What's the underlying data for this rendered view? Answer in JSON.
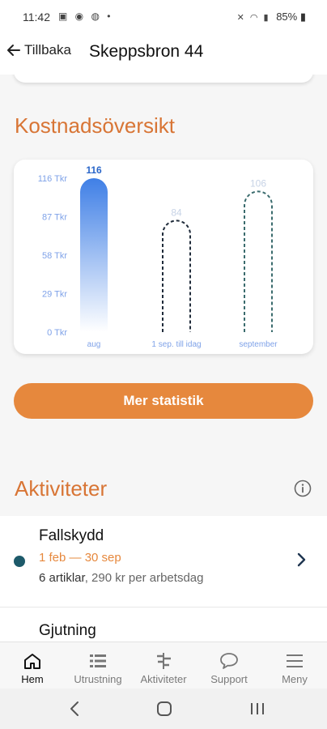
{
  "status_bar": {
    "time": "11:42",
    "battery": "85%"
  },
  "header": {
    "back_label": "Tillbaka",
    "title": "Skeppsbron 44"
  },
  "cost": {
    "section_title": "Kostnadsöversikt",
    "more_button": "Mer statistik",
    "chart_data": {
      "type": "bar",
      "categories": [
        "aug",
        "1 sep. till idag",
        "september"
      ],
      "series": [
        {
          "values": [
            116,
            84,
            106
          ]
        }
      ],
      "value_labels": [
        "116",
        "84",
        "106"
      ],
      "y_ticks": [
        "0 Tkr",
        "29 Tkr",
        "58 Tkr",
        "87 Tkr",
        "116 Tkr"
      ],
      "y_tick_values": [
        0,
        29,
        58,
        87,
        116
      ],
      "ylim": [
        0,
        116
      ],
      "styles": [
        "actual",
        "forecast",
        "forecast"
      ],
      "colors": {
        "actual": "#3f7fe6",
        "forecast_today": "#1f2b3a",
        "forecast_month": "#3a6b6d",
        "axis_text": "#7fa2e8",
        "muted_label": "#c7d3e6"
      }
    }
  },
  "activities": {
    "section_title": "Aktiviteter",
    "items": [
      {
        "name": "Fallskydd",
        "dates": "1 feb — 30 sep",
        "count": "6 artiklar",
        "rate": "290 kr per arbetsdag"
      },
      {
        "name": "Gjutning"
      }
    ]
  },
  "tabs": [
    {
      "label": "Hem",
      "icon": "home-icon"
    },
    {
      "label": "Utrustning",
      "icon": "list-icon"
    },
    {
      "label": "Aktiviteter",
      "icon": "timeline-icon"
    },
    {
      "label": "Support",
      "icon": "chat-bubble-icon"
    },
    {
      "label": "Meny",
      "icon": "hamburger-icon"
    }
  ]
}
